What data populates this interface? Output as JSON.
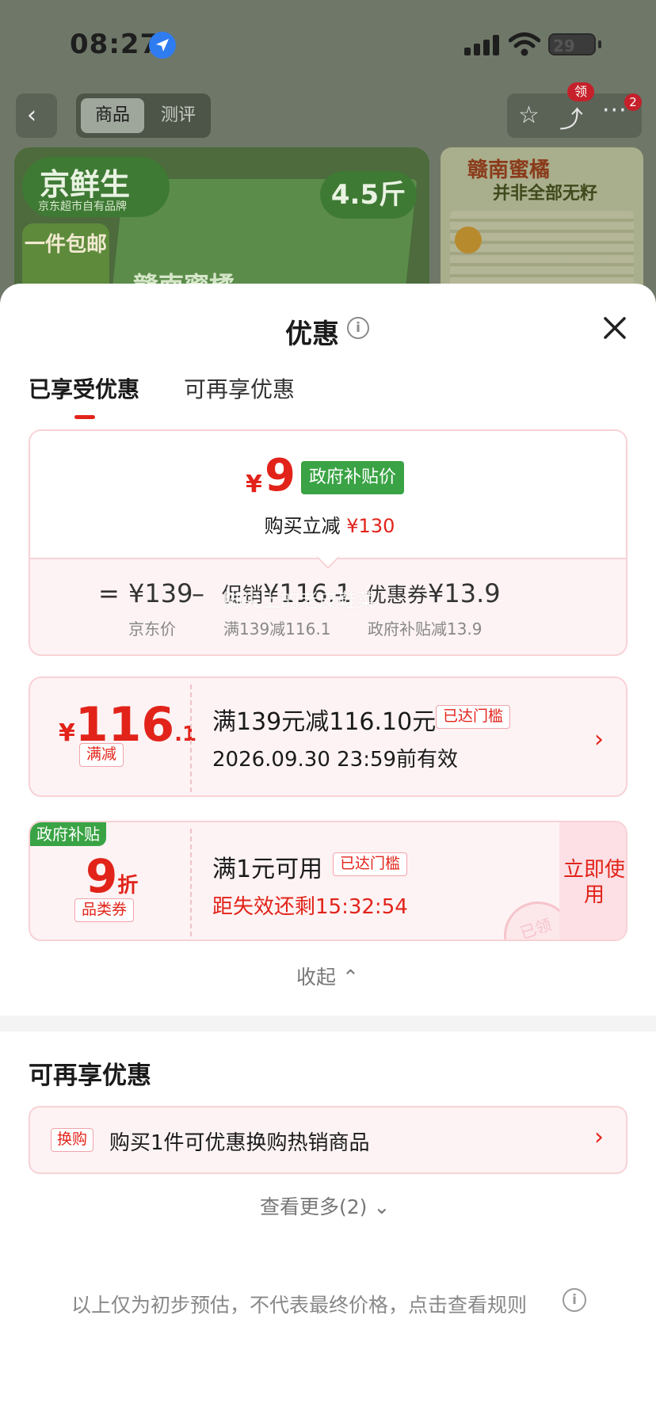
{
  "status_bar": {
    "time": "08:27",
    "battery": "29"
  },
  "nav": {
    "tabs": [
      "商品",
      "测评"
    ],
    "badge_claim": "领",
    "badge_count": "2"
  },
  "background": {
    "brand_name": "京鲜生",
    "brand_sub": "京东超市自有品牌",
    "size": "4.5斤",
    "shipping": "一件包邮",
    "box_label": "赣南蜜橘",
    "poster_title": "赣南蜜橘",
    "poster_sub": "并非全部无籽"
  },
  "sheet": {
    "title": "优惠",
    "tabs": {
      "active": "已享受优惠",
      "inactive": "可再享优惠"
    },
    "summary": {
      "currency": "¥",
      "final_price": "9",
      "tag": "政府补贴价",
      "buy_label": "购买立减",
      "buy_amount": "¥130",
      "eq": "=",
      "minus": "–",
      "base_price": "¥139",
      "base_label": "京东价",
      "promo_prefix": "促销",
      "promo_amount": "¥116.1",
      "promo_label": "满139减116.1",
      "coupon_prefix": "优惠券",
      "coupon_amount": "¥13.9",
      "coupon_label": "政府补贴减13.9"
    },
    "watermark": "脚尖上的老皮鞋菜",
    "coupons": [
      {
        "currency": "¥",
        "amount_int": "116",
        "amount_dec": ".1",
        "type": "满减",
        "title": "满139元减116.10元",
        "status": "已达门槛",
        "validity": "2026.09.30 23:59前有效"
      },
      {
        "corner": "政府补贴",
        "discount": "9",
        "discount_unit": "折",
        "type": "品类券",
        "title": "满1元可用",
        "status": "已达门槛",
        "countdown": "距失效还剩15:32:54",
        "action": "立即使用",
        "stamp": "已领"
      }
    ],
    "collapse": "收起",
    "more_section": {
      "title": "可再享优惠",
      "swap_tag": "换购",
      "swap_text": "购买1件可优惠换购热销商品",
      "see_more": "查看更多(2)"
    },
    "disclaimer": "以上仅为初步预估，不代表最终价格，点击查看规则"
  }
}
